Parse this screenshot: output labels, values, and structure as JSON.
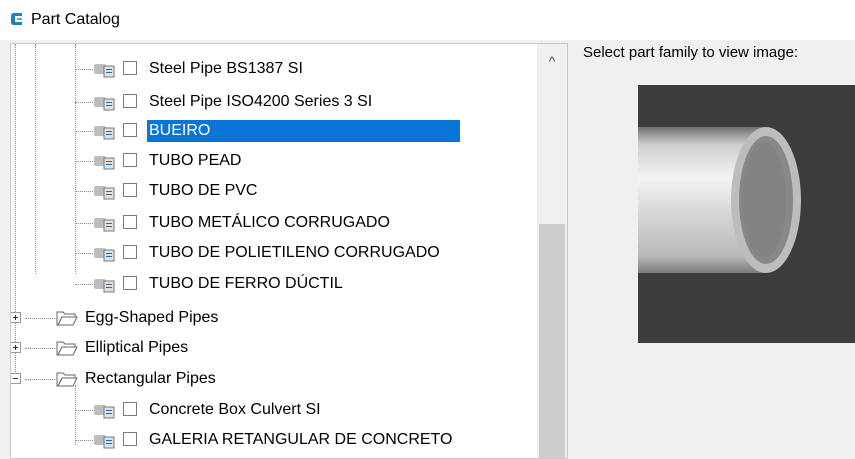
{
  "window": {
    "title": "Part Catalog"
  },
  "tree": {
    "items": [
      {
        "label": "Steel Pipe BS1387 SI",
        "selected": false
      },
      {
        "label": "Steel Pipe ISO4200 Series 3 SI",
        "selected": false
      },
      {
        "label": "BUEIRO",
        "selected": true
      },
      {
        "label": "TUBO PEAD",
        "selected": false
      },
      {
        "label": "TUBO DE PVC",
        "selected": false
      },
      {
        "label": "TUBO METÁLICO CORRUGADO",
        "selected": false
      },
      {
        "label": "TUBO DE POLIETILENO CORRUGADO",
        "selected": false
      },
      {
        "label": "TUBO DE FERRO DÚCTIL",
        "selected": false
      }
    ],
    "folders": [
      {
        "label": "Egg-Shaped Pipes",
        "expanded": false
      },
      {
        "label": "Elliptical Pipes",
        "expanded": false
      },
      {
        "label": "Rectangular Pipes",
        "expanded": true
      }
    ],
    "rect_items": [
      {
        "label": "Concrete Box Culvert SI",
        "selected": false
      },
      {
        "label": "GALERIA RETANGULAR DE CONCRETO",
        "selected": false
      }
    ],
    "scroll_up_glyph": "^"
  },
  "preview": {
    "label": "Select part family to view image:"
  },
  "colors": {
    "selection": "#0a74d7",
    "preview_bg": "#3c3c3c"
  }
}
